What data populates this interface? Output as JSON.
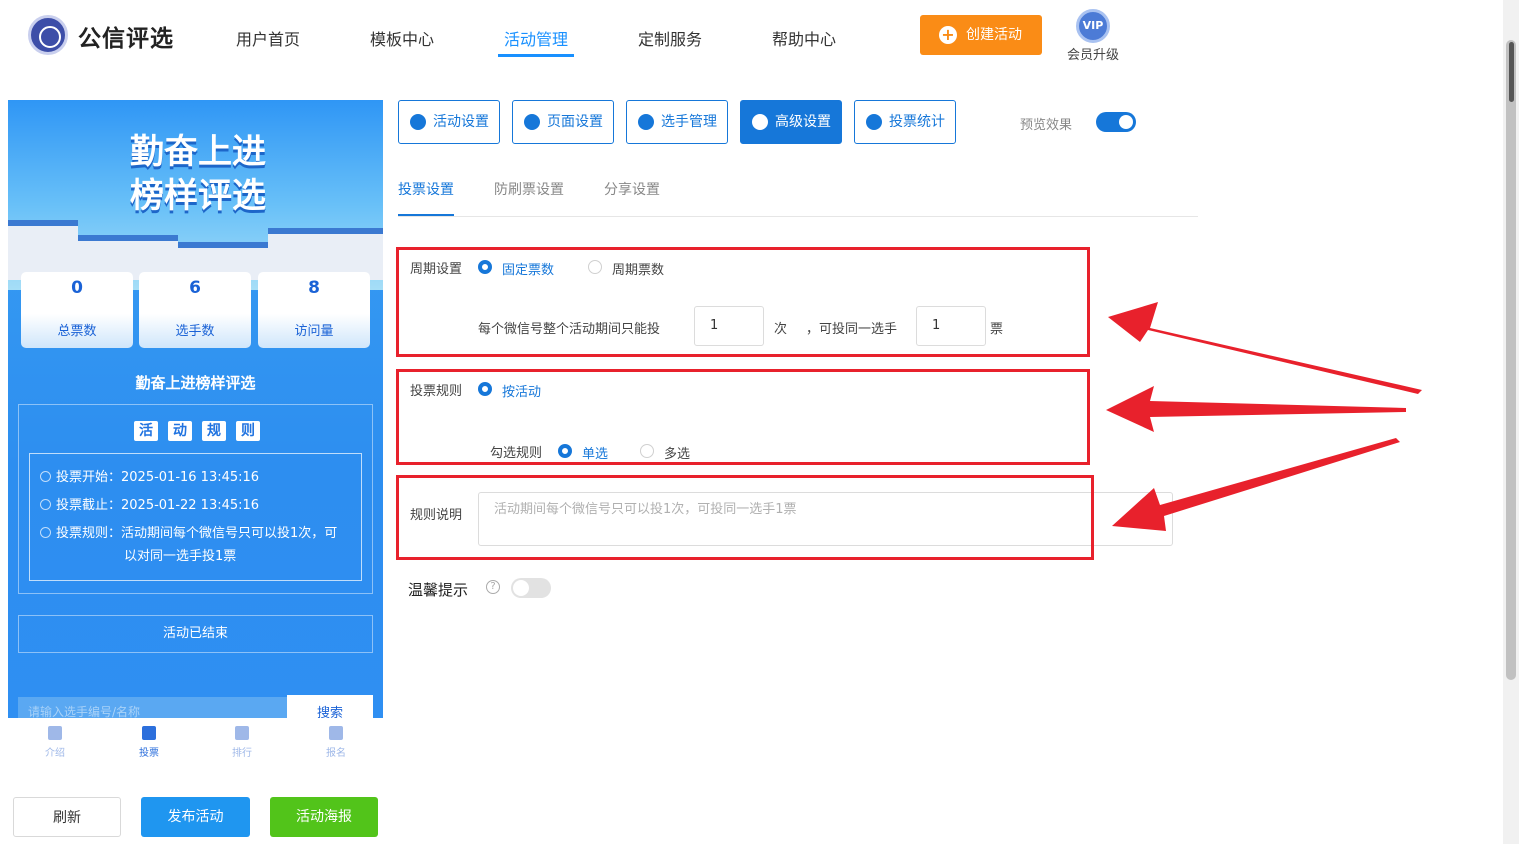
{
  "header": {
    "brand": "公信评选",
    "nav": [
      "用户首页",
      "模板中心",
      "活动管理",
      "定制服务",
      "帮助中心"
    ],
    "create_button": "创建活动",
    "vip_badge": "VIP",
    "vip_label": "会员升级",
    "accent_color": "#1890ff",
    "create_color": "#fa8c16"
  },
  "preview": {
    "banner_title_line1": "勤奋上进",
    "banner_title_line2": "榜样评选",
    "stats": [
      {
        "value": "0",
        "label": "总票数"
      },
      {
        "value": "6",
        "label": "选手数"
      },
      {
        "value": "8",
        "label": "访问量"
      }
    ],
    "activity_title": "勤奋上进榜样评选",
    "rules_heading_chars": [
      "活",
      "动",
      "规",
      "则"
    ],
    "rule_lines": [
      "投票开始：2025-01-16 13:45:16",
      "投票截止：2025-01-22 13:45:16",
      "投票规则：活动期间每个微信号只可以投1次，可",
      "以对同一选手投1票"
    ],
    "ended_text": "活动已结束",
    "search_placeholder": "请输入选手编号/名称",
    "search_button": "搜索",
    "tabbar": [
      "介绍",
      "投票",
      "排行",
      "报名"
    ]
  },
  "bottom_buttons": {
    "refresh": "刷新",
    "publish": "发布活动",
    "poster": "活动海报"
  },
  "toolbar": {
    "buttons": [
      "活动设置",
      "页面设置",
      "选手管理",
      "高级设置",
      "投票统计"
    ],
    "active_index": 3,
    "preview_label": "预览效果",
    "preview_on": true
  },
  "subtabs": [
    "投票设置",
    "防刷票设置",
    "分享设置"
  ],
  "form": {
    "cycle": {
      "label": "周期设置",
      "options": [
        "固定票数",
        "周期票数"
      ],
      "selected": "固定票数",
      "line_prefix": "每个微信号整个活动期间只能投",
      "times_value": "1",
      "times_unit": "次",
      "line_mid": "，可投同一选手",
      "votes_value": "1",
      "votes_unit": "票"
    },
    "vote_rule": {
      "label": "投票规则",
      "option": "按活动",
      "check_label": "勾选规则",
      "check_options": [
        "单选",
        "多选"
      ],
      "check_selected": "单选"
    },
    "rule_desc": {
      "label": "规则说明",
      "placeholder": "活动期间每个微信号只可以投1次，可投同一选手1票"
    },
    "tip": {
      "label": "温馨提示",
      "help_icon": "question-icon",
      "enabled": false
    }
  },
  "annotation_color": "#e8212c"
}
